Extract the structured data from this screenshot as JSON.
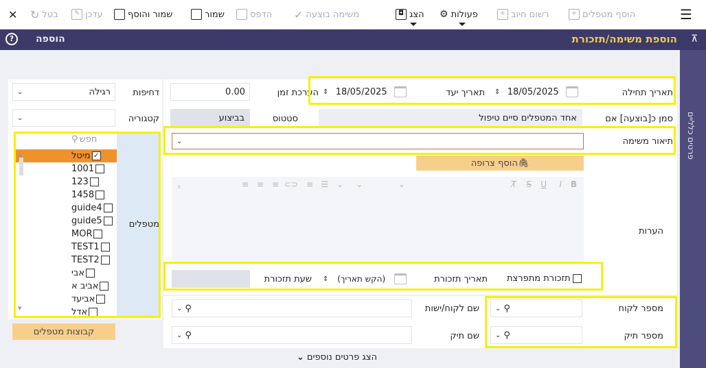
{
  "toolbar": {
    "menu_icon": "hamburger-icon",
    "add_handlers": "הוסף מטפלים",
    "register_charge": "רשום חיוב",
    "actions": "פעולות",
    "show": "הצג",
    "task_done": "משימה בוצעה",
    "print": "הדפס",
    "save": "שמור",
    "save_add": "שמור והוסף",
    "update": "עדכן",
    "cancel": "בטל"
  },
  "header": {
    "title": "הוספת משימה/תזכורת",
    "add_label": "הוספה"
  },
  "rail": {
    "label": "פרטים כלליים"
  },
  "form": {
    "start_date_label": "תאריך תחילה",
    "start_date_value": "18/05/2025",
    "due_date_label": "תאריך יעד",
    "due_date_value": "18/05/2025",
    "time_estimate_label": "הערכת זמן",
    "time_estimate_value": "0.00",
    "urgency_label": "דחיפות",
    "urgency_value": "רגילה",
    "mark_done_label": "סמן כ[בוצעה] אם",
    "mark_done_value": "אחד המטפלים סיים טיפול",
    "status_label": "סטטוס",
    "status_value": "בביצוע",
    "category_label": "קטגוריה",
    "description_label": "תיאור משימה",
    "add_attachment": "הוסף צרופה",
    "notes_label": "הערות",
    "handlers_label": "מטפלים",
    "search_placeholder": "חפש",
    "handlers": [
      {
        "name": "מיטל",
        "checked": true
      },
      {
        "name": "1001",
        "checked": false
      },
      {
        "name": "123",
        "checked": false
      },
      {
        "name": "1458",
        "checked": false
      },
      {
        "name": "guide4",
        "checked": false
      },
      {
        "name": "guide5",
        "checked": false
      },
      {
        "name": "MOR",
        "checked": false
      },
      {
        "name": "TEST1",
        "checked": false
      },
      {
        "name": "TEST2",
        "checked": false
      },
      {
        "name": "אבי",
        "checked": false
      },
      {
        "name": "אביב א",
        "checked": false
      },
      {
        "name": "אביעד",
        "checked": false
      },
      {
        "name": "אדל",
        "checked": false
      }
    ],
    "handler_groups": "קבוצות מטפלים",
    "recurring_reminder": "תזכורת מתפרצת",
    "reminder_date_label": "תאריך תזכורת",
    "reminder_date_value": "(הקש תאריך)",
    "reminder_time_label": "שעת תזכורת",
    "client_number_label": "מספר לקוח",
    "client_name_label": "שם לקוח/ישות",
    "case_number_label": "מספר תיק",
    "case_name_label": "שם תיק",
    "more_details": "הצג פרטים נוספים"
  },
  "colors": {
    "header_bg": "#3b3a68",
    "header_title": "#f2c94c",
    "selected_row": "#f0922b",
    "orange_button": "#f7cf8c",
    "highlight": "#f5f10a"
  }
}
